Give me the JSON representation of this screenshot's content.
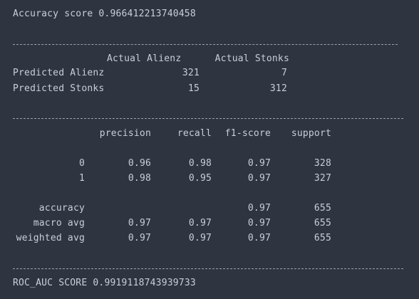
{
  "accuracy_label": "Accuracy score",
  "accuracy_value": "0.966412213740458",
  "confusion": {
    "col_headers": [
      "Actual Alienz",
      "Actual Stonks"
    ],
    "rows": [
      {
        "label": "Predicted Alienz",
        "values": [
          "321",
          "7"
        ]
      },
      {
        "label": "Predicted Stonks",
        "values": [
          "15",
          "312"
        ]
      }
    ]
  },
  "report": {
    "headers": [
      "precision",
      "recall",
      "f1-score",
      "support"
    ],
    "rows": [
      {
        "label": "0",
        "values": [
          "0.96",
          "0.98",
          "0.97",
          "328"
        ]
      },
      {
        "label": "1",
        "values": [
          "0.98",
          "0.95",
          "0.97",
          "327"
        ]
      },
      {
        "label": "accuracy",
        "values": [
          "",
          "",
          "0.97",
          "655"
        ]
      },
      {
        "label": "macro avg",
        "values": [
          "0.97",
          "0.97",
          "0.97",
          "655"
        ]
      },
      {
        "label": "weighted avg",
        "values": [
          "0.97",
          "0.97",
          "0.97",
          "655"
        ]
      }
    ]
  },
  "roc_label": "ROC_AUC SCORE",
  "roc_value": "0.9919118743939733"
}
